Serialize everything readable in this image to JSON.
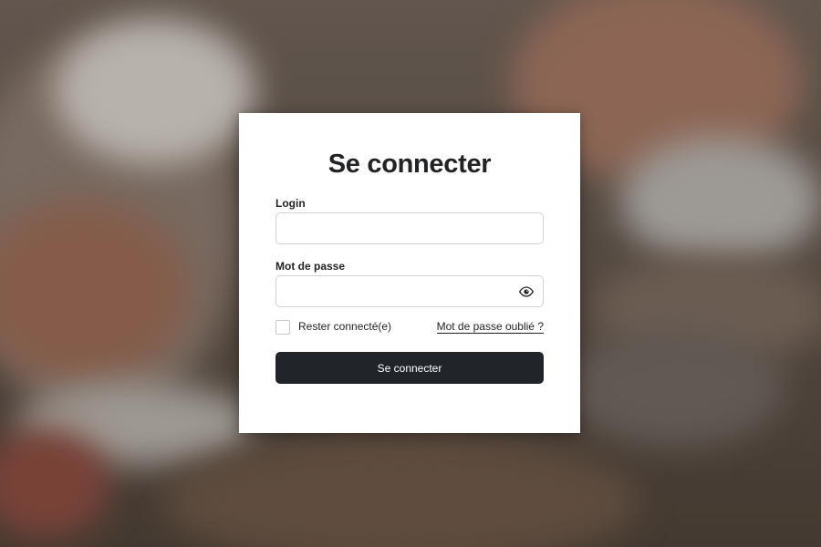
{
  "form": {
    "title": "Se connecter",
    "login_label": "Login",
    "login_value": "",
    "password_label": "Mot de passe",
    "password_value": "",
    "password_toggle_icon": "eye-icon",
    "remember_label": "Rester connecté(e)",
    "remember_checked": false,
    "forgot_link": "Mot de passe oublié ?",
    "submit_label": "Se connecter"
  },
  "colors": {
    "button_bg": "#212529",
    "text": "#212325",
    "input_border": "#cfd3d7",
    "card_bg": "#ffffff"
  }
}
